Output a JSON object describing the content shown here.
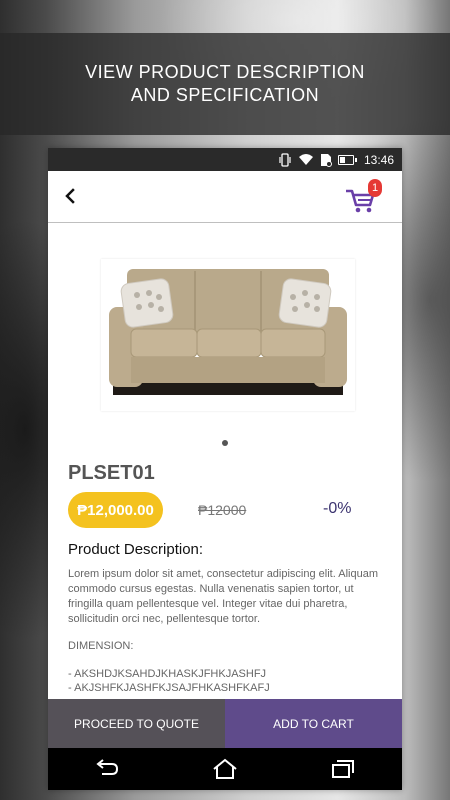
{
  "banner": {
    "line1": "VIEW PRODUCT DESCRIPTION",
    "line2": "AND SPECIFICATION"
  },
  "status_bar": {
    "time": "13:46",
    "icons": [
      "vibrate-icon",
      "wifi-icon",
      "sim-icon",
      "battery-icon"
    ]
  },
  "header": {
    "back_icon": "back-arrow-icon",
    "cart_icon": "shopping-cart-icon",
    "cart_count": "1",
    "accent_color": "#6a3fa8"
  },
  "product": {
    "image": "sofa-image",
    "code": "PLSET01",
    "price": "₱12,000.00",
    "old_price": "₱12000",
    "discount": "-0%",
    "price_color": "#f4c21f"
  },
  "description": {
    "title": "Product Description:",
    "body": "Lorem ipsum dolor sit amet, consectetur adipiscing elit. Aliquam commodo cursus egestas. Nulla venenatis sapien tortor, ut fringilla quam pellentesque vel. Integer vitae dui pharetra, sollicitudin orci nec, pellentesque tortor.",
    "dimension_label": "DIMENSION:",
    "dimensions": [
      "- AKSHDJKSAHDJKHASKJFHKJASHFJ",
      "- AKJSHFKJASHFKJSAJFHKASHFKAFJ"
    ]
  },
  "actions": {
    "quote_label": "PROCEED TO QUOTE",
    "cart_label": "ADD TO CART",
    "quote_color": "#555158",
    "cart_color": "#5f4b8b"
  },
  "navbar": {
    "icons": [
      "back-icon",
      "home-icon",
      "recent-apps-icon"
    ]
  }
}
